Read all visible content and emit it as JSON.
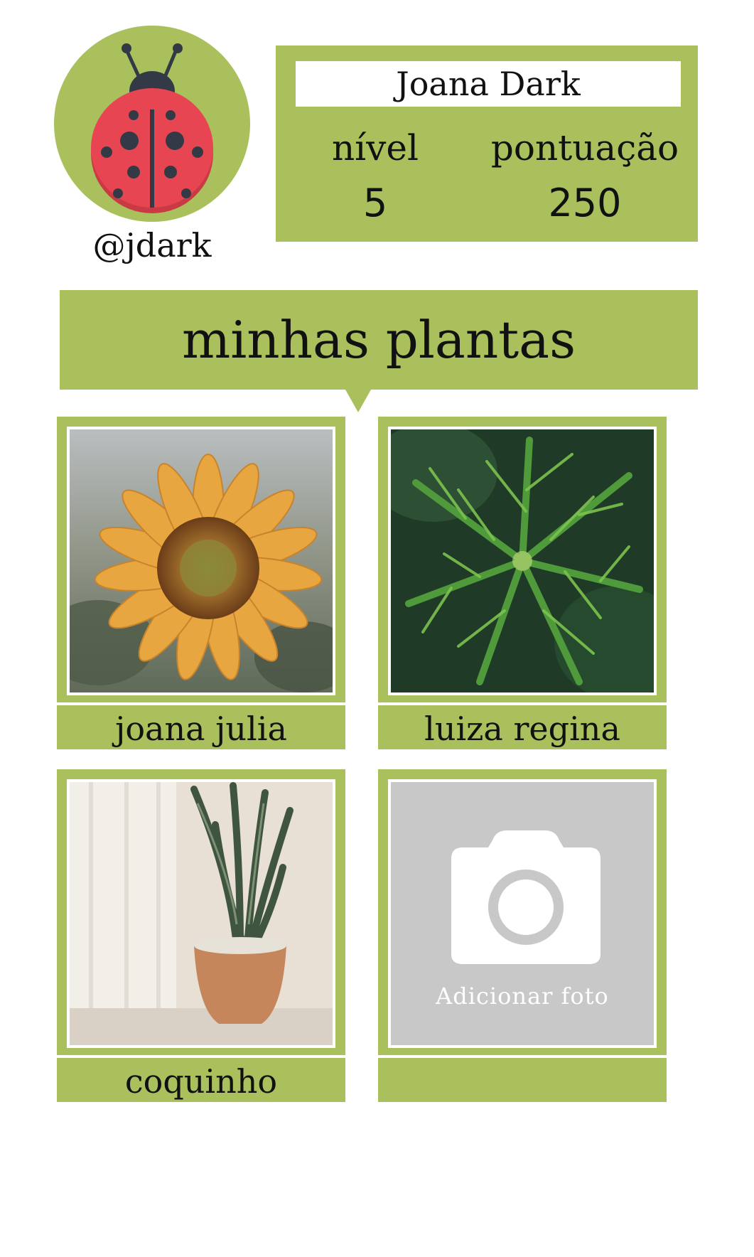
{
  "profile": {
    "handle": "@jdark",
    "name": "Joana Dark",
    "level_label": "nível",
    "level_value": "5",
    "score_label": "pontuação",
    "score_value": "250"
  },
  "section": {
    "title": "minhas plantas"
  },
  "plants": [
    {
      "name": "joana julia",
      "photo": "sunflower-photo"
    },
    {
      "name": "luiza regina",
      "photo": "palm-leaves-photo"
    },
    {
      "name": "coquinho",
      "photo": "snake-plant-photo"
    }
  ],
  "add_card": {
    "text": "Adicionar foto",
    "icon": "camera-icon",
    "label": ""
  },
  "colors": {
    "accent_green": "#a9c05c",
    "placeholder_gray": "#c8c8c8",
    "ladybug_red": "#e84553"
  }
}
